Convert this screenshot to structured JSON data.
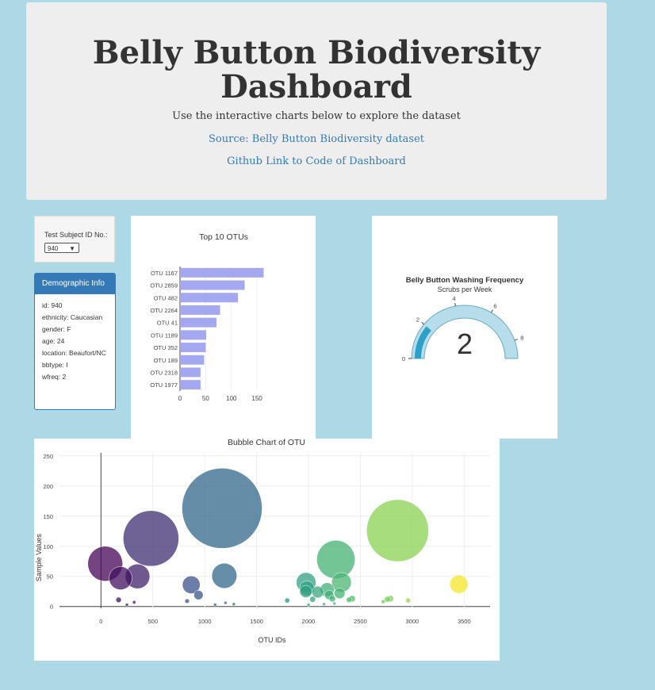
{
  "header": {
    "title": "Belly Button Biodiversity Dashboard",
    "lead": "Use the interactive charts below to explore the dataset",
    "link1": "Source: Belly Button Biodiversity dataset",
    "link2": "Github Link to Code of Dashboard"
  },
  "selector": {
    "label": "Test Subject ID No.:",
    "value": "940"
  },
  "demographic": {
    "title": "Demographic Info",
    "items": [
      "id: 940",
      "ethnicity: Caucasian",
      "gender: F",
      "age: 24",
      "location: Beaufort/NC",
      "bbtype: I",
      "wfreq: 2"
    ]
  },
  "colors": {
    "bar": "#a3a8f0",
    "panel": "#337ab7",
    "gauge": "#7cbdd6",
    "gauge_fill": "#2ba0c9"
  },
  "chart_data": [
    {
      "type": "bar",
      "orientation": "horizontal",
      "title": "Top 10 OTUs",
      "categories": [
        "OTU 1167",
        "OTU 2859",
        "OTU 482",
        "OTU 2264",
        "OTU 41",
        "OTU 1189",
        "OTU 352",
        "OTU 189",
        "OTU 2318",
        "OTU 1977"
      ],
      "values": [
        163,
        126,
        113,
        78,
        71,
        51,
        50,
        47,
        40,
        40
      ],
      "xticks": [
        0,
        50,
        100,
        150
      ],
      "xlim": [
        0,
        170
      ]
    },
    {
      "type": "gauge",
      "title": "Belly Button Washing Frequency",
      "subtitle": "Scrubs per Week",
      "value": 2,
      "range": [
        0,
        9
      ],
      "ticks": [
        0,
        2,
        4,
        6,
        8
      ]
    },
    {
      "type": "scatter",
      "title": "Bubble Chart of OTU",
      "xlabel": "OTU IDs",
      "ylabel": "Sample Values",
      "xlim": [
        -400,
        3750
      ],
      "ylim": [
        -3,
        255
      ],
      "xticks": [
        0,
        500,
        1000,
        1500,
        2000,
        2500,
        3000,
        3500
      ],
      "yticks": [
        0,
        50,
        100,
        150,
        200,
        250
      ],
      "points": [
        {
          "x": 41,
          "y": 71
        },
        {
          "x": 189,
          "y": 47
        },
        {
          "x": 352,
          "y": 50
        },
        {
          "x": 482,
          "y": 113
        },
        {
          "x": 870,
          "y": 36
        },
        {
          "x": 940,
          "y": 19
        },
        {
          "x": 1167,
          "y": 163
        },
        {
          "x": 1189,
          "y": 51
        },
        {
          "x": 170,
          "y": 11
        },
        {
          "x": 250,
          "y": 3
        },
        {
          "x": 320,
          "y": 7
        },
        {
          "x": 830,
          "y": 9
        },
        {
          "x": 1100,
          "y": 3
        },
        {
          "x": 1200,
          "y": 6
        },
        {
          "x": 1280,
          "y": 4
        },
        {
          "x": 1795,
          "y": 10
        },
        {
          "x": 1977,
          "y": 40
        },
        {
          "x": 1985,
          "y": 30
        },
        {
          "x": 1975,
          "y": 25
        },
        {
          "x": 2040,
          "y": 12
        },
        {
          "x": 2090,
          "y": 24
        },
        {
          "x": 2180,
          "y": 28
        },
        {
          "x": 2200,
          "y": 19
        },
        {
          "x": 2230,
          "y": 13
        },
        {
          "x": 2264,
          "y": 78
        },
        {
          "x": 2300,
          "y": 22
        },
        {
          "x": 2318,
          "y": 40
        },
        {
          "x": 2390,
          "y": 11
        },
        {
          "x": 2420,
          "y": 13
        },
        {
          "x": 2720,
          "y": 8
        },
        {
          "x": 2760,
          "y": 12
        },
        {
          "x": 2790,
          "y": 13
        },
        {
          "x": 2859,
          "y": 126
        },
        {
          "x": 2960,
          "y": 10
        },
        {
          "x": 3450,
          "y": 37
        },
        {
          "x": 2150,
          "y": 4
        },
        {
          "x": 2250,
          "y": 5
        },
        {
          "x": 2000,
          "y": 3
        }
      ]
    }
  ]
}
